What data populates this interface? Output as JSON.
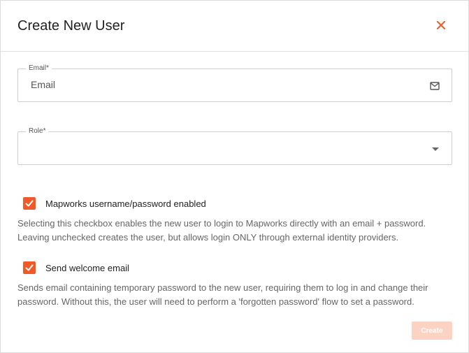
{
  "dialog": {
    "title": "Create New User",
    "close_icon": "close-icon"
  },
  "email_field": {
    "label": "Email*",
    "placeholder": "Email",
    "value": "",
    "icon": "mail-icon"
  },
  "role_field": {
    "label": "Role*",
    "value": "",
    "icon": "chevron-down-icon"
  },
  "options": [
    {
      "label": "Mapworks username/password enabled",
      "checked": true,
      "help": "Selecting this checkbox enables the new user to login to Mapworks directly with an email + password. Leaving unchecked creates the user, but allows login ONLY through external identity providers."
    },
    {
      "label": "Send welcome email",
      "checked": true,
      "help": "Sends email containing temporary password to the new user, requiring them to log in and change their password. Without this, the user will need to perform a 'forgotten password' flow to set a password."
    }
  ],
  "actions": {
    "create_label": "Create",
    "create_enabled": false
  },
  "colors": {
    "accent": "#f05a28",
    "accent_disabled": "#fcd3c3",
    "border": "#cfcfcf"
  }
}
